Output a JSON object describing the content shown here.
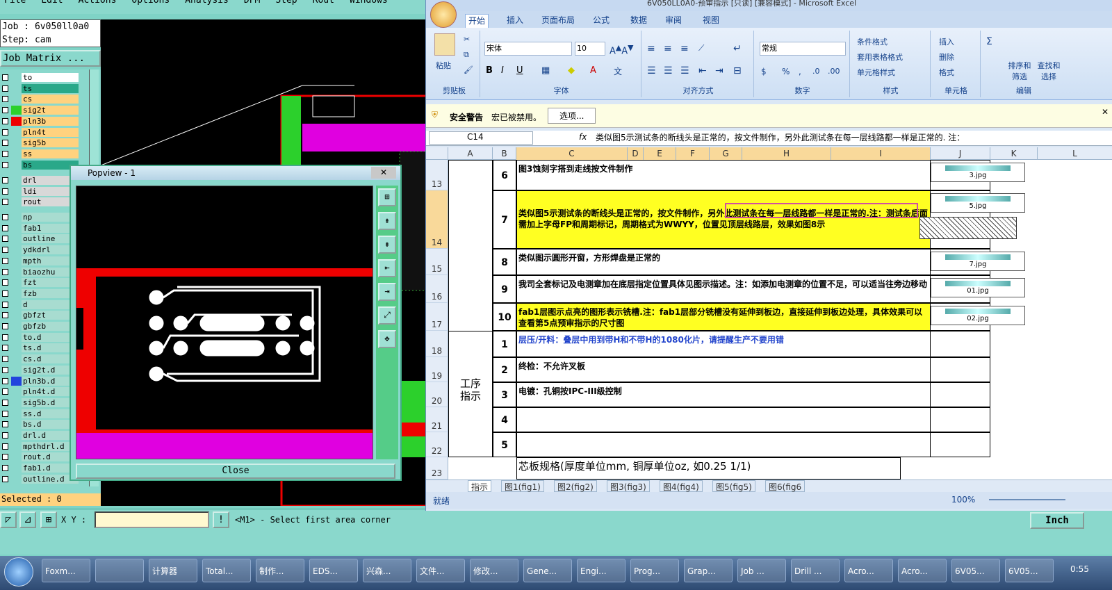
{
  "cam": {
    "menu": [
      "File",
      "Edit",
      "Actions",
      "Options",
      "Analysis",
      "DFM",
      "Step",
      "Rout",
      "Windows"
    ],
    "job_label": "Job : 6v050ll0a0",
    "step_label": "Step: cam",
    "job_matrix": "Job Matrix ...",
    "layers": [
      {
        "name": "to",
        "color": "#ffffff"
      },
      {
        "name": "ts",
        "color": "#2aa889"
      },
      {
        "name": "cs",
        "color": "#ffd27f"
      },
      {
        "name": "sig2t",
        "color": "#ffd27f"
      },
      {
        "name": "pln3b",
        "color": "#ffd27f"
      },
      {
        "name": "pln4t",
        "color": "#ffd27f"
      },
      {
        "name": "sig5b",
        "color": "#ffd27f"
      },
      {
        "name": "ss",
        "color": "#ffd27f"
      },
      {
        "name": "bs",
        "color": "#2aa889"
      },
      {
        "name": "drl",
        "color": "#d8d8d8"
      },
      {
        "name": "ldi",
        "color": "#d8d8d8"
      },
      {
        "name": "rout",
        "color": "#d8d8d8"
      },
      {
        "name": "np",
        "color": "#a8dcd0"
      },
      {
        "name": "fab1",
        "color": "#a8dcd0"
      },
      {
        "name": "outline",
        "color": "#a8dcd0"
      },
      {
        "name": "ydkdrl",
        "color": "#a8dcd0"
      },
      {
        "name": "mpth",
        "color": "#a8dcd0"
      },
      {
        "name": "biaozhu",
        "color": "#a8dcd0"
      },
      {
        "name": "fzt",
        "color": "#a8dcd0"
      },
      {
        "name": "fzb",
        "color": "#a8dcd0"
      },
      {
        "name": "d",
        "color": "#a8dcd0"
      },
      {
        "name": "gbfzt",
        "color": "#a8dcd0"
      },
      {
        "name": "gbfzb",
        "color": "#a8dcd0"
      },
      {
        "name": "to.d",
        "color": "#a8dcd0"
      },
      {
        "name": "ts.d",
        "color": "#a8dcd0"
      },
      {
        "name": "cs.d",
        "color": "#a8dcd0"
      },
      {
        "name": "sig2t.d",
        "color": "#a8dcd0"
      },
      {
        "name": "pln3b.d",
        "color": "#a8dcd0"
      },
      {
        "name": "pln4t.d",
        "color": "#a8dcd0"
      },
      {
        "name": "sig5b.d",
        "color": "#a8dcd0"
      },
      {
        "name": "ss.d",
        "color": "#a8dcd0"
      },
      {
        "name": "bs.d",
        "color": "#a8dcd0"
      },
      {
        "name": "drl.d",
        "color": "#a8dcd0"
      },
      {
        "name": "mpthdrl.d",
        "color": "#a8dcd0"
      },
      {
        "name": "rout.d",
        "color": "#a8dcd0"
      },
      {
        "name": "fab1.d",
        "color": "#a8dcd0"
      },
      {
        "name": "outline.d",
        "color": "#a8dcd0"
      }
    ],
    "selected": "Selected : 0",
    "xy_label": "X Y :",
    "prompt": "<M1> - Select first area corner",
    "units": "Inch"
  },
  "popview": {
    "title": "Popview - 1",
    "close": "Close"
  },
  "excel": {
    "title": "6V050LL0A0-预审指示 [只读] [兼容模式] - Microsoft Excel",
    "tabs": [
      "开始",
      "插入",
      "页面布局",
      "公式",
      "数据",
      "审阅",
      "视图"
    ],
    "font_name": "宋体",
    "font_size": "10",
    "number_format": "常规",
    "groups": [
      "剪贴板",
      "字体",
      "对齐方式",
      "数字",
      "样式",
      "单元格",
      "编辑"
    ],
    "paste": "粘贴",
    "styles": [
      "条件格式",
      "套用表格格式",
      "单元格样式"
    ],
    "cells_btns": [
      "插入",
      "删除",
      "格式"
    ],
    "edit_btns": [
      "排序和筛选",
      "查找和选择"
    ],
    "security_title": "安全警告",
    "security_msg": "宏已被禁用。",
    "options": "选项...",
    "namebox": "C14",
    "formula": "类似图5示测试条的断线头是正常的，按文件制作，另外此测试条在每一层线路都一样是正常的. 注：",
    "cols": [
      "A",
      "B",
      "C",
      "D",
      "E",
      "F",
      "G",
      "H",
      "I",
      "J",
      "K",
      "L"
    ],
    "rows": [
      {
        "rn": "13",
        "no": "6",
        "text": "图3蚀刻字搭到走线按文件制作",
        "img": "3.jpg"
      },
      {
        "rn": "14",
        "no": "7",
        "text": "类似图5示测试条的断线头是正常的，按文件制作，另外此测试条在每一层线路都一样是正常的.注：测试条后面需加上字母FP和周期标记，周期格式为WWYY，位置见顶层线路层，效果如图8示",
        "img": "5.jpg"
      },
      {
        "rn": "15",
        "no": "8",
        "text": "类似图示圆形开窗，方形焊盘是正常的",
        "img": "7.jpg"
      },
      {
        "rn": "16",
        "no": "9",
        "text": "我司全套标记及电测章加在底层指定位置具体见图示描述。注：如添加电测章的位置不足，可以适当往旁边移动",
        "img": "01.jpg"
      },
      {
        "rn": "17",
        "no": "10",
        "text": "fab1层图示点亮的图形表示铣槽.注：fab1层部分铣槽没有延伸到板边，直接延伸到板边处理，具体效果可以查看第5点预审指示的尺寸图",
        "img": "02.jpg"
      },
      {
        "rn": "18",
        "no": "1",
        "text": "层压/开料：叠层中用到带H和不带H的1080化片，请提醒生产不要用错"
      },
      {
        "rn": "19",
        "no": "2",
        "text": "终检：不允许叉板"
      },
      {
        "rn": "20",
        "no": "3",
        "text": "电镀：孔铜按IPC-III级控制"
      },
      {
        "rn": "21",
        "no": "4",
        "text": ""
      },
      {
        "rn": "22",
        "no": "5",
        "text": ""
      },
      {
        "rn": "23",
        "no": "",
        "text": "芯板规格(厚度单位mm, 铜厚单位oz, 如0.25 1/1)"
      }
    ],
    "merged_label": "工序指示",
    "sheet_tabs": [
      "指示",
      "图1(fig1)",
      "图2(fig2)",
      "图3(fig3)",
      "图4(fig4)",
      "图5(fig5)",
      "图6(fig6"
    ],
    "status_left": "就绪",
    "zoom": "100%"
  },
  "taskbar": {
    "items": [
      "Foxm...",
      "",
      "计算器",
      "Total...",
      "制作...",
      "EDS...",
      "兴森...",
      "文件...",
      "修改...",
      "Gene...",
      "Engi...",
      "Prog...",
      "Grap...",
      "Job ...",
      "Drill ...",
      "Acro...",
      "Acro...",
      "6V05...",
      "6V05..."
    ],
    "clock": "0:55"
  }
}
